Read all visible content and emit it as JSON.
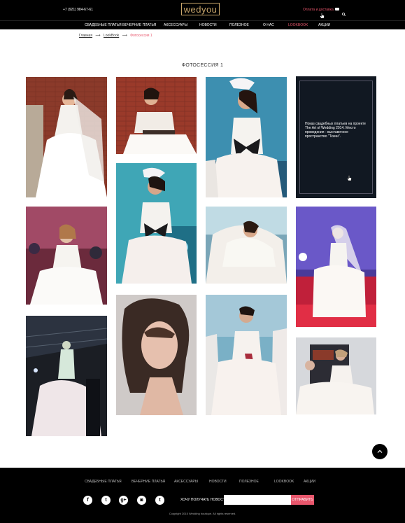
{
  "header": {
    "phone": "+7 (921) 984-67-61",
    "logo": "wedyou",
    "delivery_link": "Оплата и доставка",
    "chat_icon": "chat-icon",
    "search_icon": "search-icon"
  },
  "nav": {
    "items": [
      {
        "label": "СВАДЕБНЫЕ ПЛАТЬЯ"
      },
      {
        "label": "ВЕЧЕРНИЕ ПЛАТЬЯ"
      },
      {
        "label": "АКСЕССУАРЫ"
      },
      {
        "label": "НОВОСТИ"
      },
      {
        "label": "ПОЛЕЗНОЕ"
      },
      {
        "label": "О НАС"
      },
      {
        "label": "LOOKBOOK"
      },
      {
        "label": "АКЦИИ"
      }
    ],
    "active_color": "#e8566c"
  },
  "breadcrumb": {
    "home": "Главная",
    "section": "LookBook",
    "current": "Фотосессия 1"
  },
  "page": {
    "title": "ФОТОСЕССИЯ 1"
  },
  "info_tile": {
    "text": "Показ свадебных платьев на проекте The Art of Wedding 2014. Место проведения - выставочное пространство \"Ткачи\"."
  },
  "footer": {
    "nav": [
      "СВАДЕБНЫЕ ПЛАТЬЯ",
      "ВЕЧЕРНИЕ ПЛАТЬЯ",
      "АКСЕССУАРЫ",
      "НОВОСТИ",
      "ПОЛЕЗНОЕ",
      "LOOKBOOK",
      "АКЦИИ"
    ],
    "social_icons": [
      "facebook-icon",
      "twitter-icon",
      "google-plus-icon",
      "instagram-icon",
      "tumblr-icon"
    ],
    "social_glyphs": [
      "f",
      "t",
      "g+",
      "◙",
      "t"
    ],
    "subscribe_label": "ХОЧУ ПОЛУЧАТЬ НОВОСТИ",
    "subscribe_value": "",
    "subscribe_button": "ОТПРАВИТЬ",
    "copyright": "Copyright 2015 Wedding boutique. All rights reserved."
  },
  "colors": {
    "accent": "#e8566c",
    "dark": "#000000",
    "gold": "#c9a66b"
  }
}
